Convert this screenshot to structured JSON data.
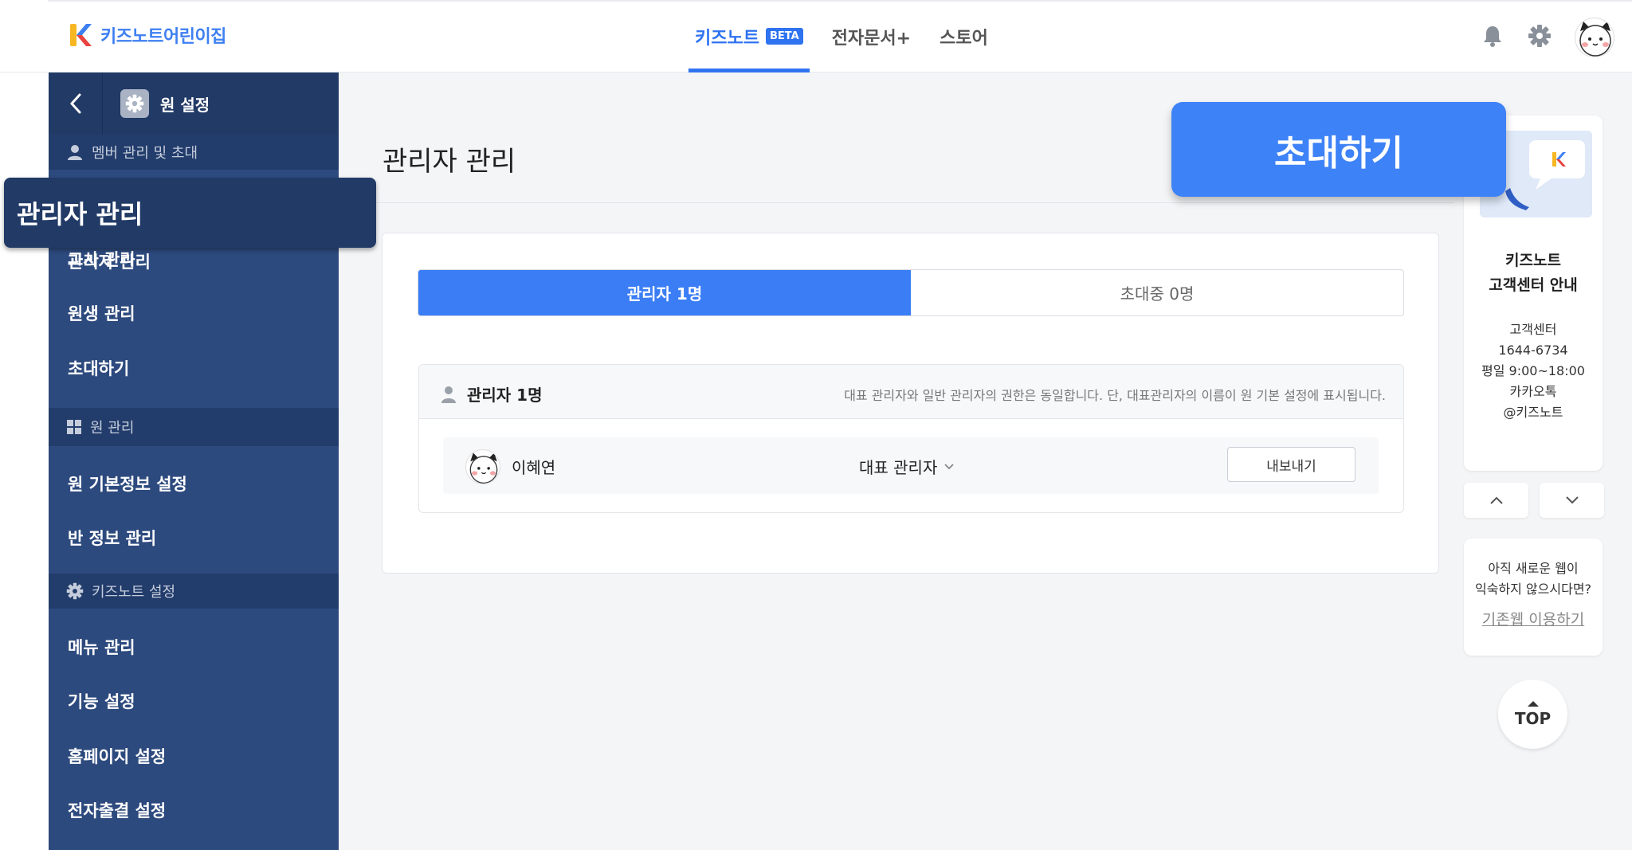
{
  "header": {
    "logo_text": "키즈노트어린이집",
    "nav": [
      {
        "label": "키즈노트",
        "badge": "BETA",
        "active": true
      },
      {
        "label": "전자문서+"
      },
      {
        "label": "스토어"
      }
    ],
    "icons": [
      "bell-icon",
      "gear-icon",
      "avatar"
    ]
  },
  "sidebar": {
    "title": "원 설정",
    "sections": [
      {
        "label": "멤버 관리 및 초대",
        "icon": "person-icon"
      },
      {
        "label": "원 관리",
        "icon": "grid-icon"
      },
      {
        "label": "키즈노트 설정",
        "icon": "gear-icon"
      }
    ],
    "items": [
      "관리자 관리",
      "교사 관리",
      "원생 관리",
      "초대하기",
      "원 기본정보 설정",
      "반 정보 관리",
      "메뉴 관리",
      "기능 설정",
      "홈페이지 설정",
      "전자출결 설정"
    ]
  },
  "tooltip_left": "관리자 관리",
  "invite_button": "초대하기",
  "main": {
    "title": "관리자 관리",
    "tabs": [
      {
        "label": "관리자 1명",
        "active": true
      },
      {
        "label": "초대중 0명",
        "active": false
      }
    ],
    "admin_section": {
      "title": "관리자 1명",
      "note": "대표 관리자와 일반 관리자의 권한은 동일합니다. 단, 대표관리자의 이름이 원 기본 설정에 표시됩니다.",
      "rows": [
        {
          "name": "이혜연",
          "role": "대표 관리자",
          "action": "내보내기"
        }
      ]
    }
  },
  "right_rail": {
    "cs_title_1": "키즈노트",
    "cs_title_2": "고객센터 안내",
    "cs_info": [
      "고객센터",
      "1644-6734",
      "평일 9:00~18:00",
      "카카오톡",
      "@키즈노트"
    ],
    "legacy_text_1": "아직 새로운 웹이",
    "legacy_text_2": "익숙하지 않으시다면?",
    "legacy_link": "기존웹 이용하기",
    "top_label": "TOP"
  },
  "colors": {
    "primary": "#3a7df5",
    "sidebar_bg": "#2d4a7e",
    "sidebar_dark": "#213a66",
    "page_bg": "#f4f5f7"
  }
}
